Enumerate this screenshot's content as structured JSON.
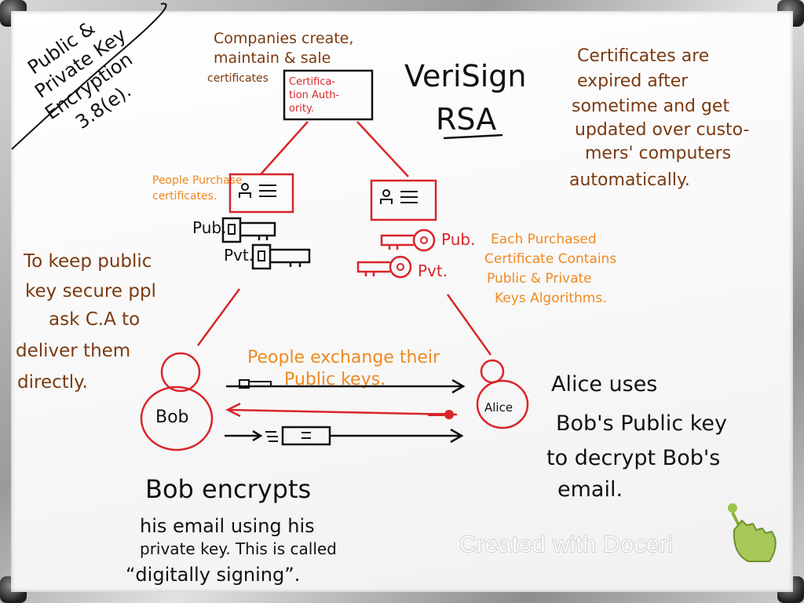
{
  "title_note": {
    "line1": "Public &",
    "line2": "Private Key",
    "line3": "Encryption",
    "line4": "3.8(e)."
  },
  "companies_note": {
    "line1": "Companies create,",
    "line2": "maintain & sale",
    "line3": "certificates"
  },
  "ca_box": {
    "line1": "Certifica-",
    "line2": "tion Auth-",
    "line3": "ority."
  },
  "verisign": {
    "line1": "VeriSign",
    "line2": "RSA"
  },
  "expiry_note": {
    "line1": "Certificates are",
    "line2": "expired after",
    "line3": "sometime and get",
    "line4": "updated over custo-",
    "line5": "mers' computers",
    "line6": "automatically."
  },
  "purchase_note": {
    "line1": "People Purchase",
    "line2": "certificates."
  },
  "key_labels": {
    "left_pub": "Pub.",
    "left_pvt": "Pvt.",
    "right_pub": "Pub.",
    "right_pvt": "Pvt."
  },
  "contains_note": {
    "line1": "Each Purchased",
    "line2": "Certificate Contains",
    "line3": "Public & Private",
    "line4": "Keys Algorithms."
  },
  "secure_note": {
    "line1": "To keep public",
    "line2": "key secure ppl",
    "line3": "ask C.A to",
    "line4": "deliver them",
    "line5": "directly."
  },
  "exchange_note": {
    "line1": "People exchange their",
    "line2": "Public keys."
  },
  "bob_label": "Bob",
  "alice_label": "Alice",
  "alice_note": {
    "line1": "Alice uses",
    "line2": "Bob's Public key",
    "line3": "to decrypt Bob's",
    "line4": "email."
  },
  "bob_note": {
    "line1": "Bob encrypts",
    "line2": "his email using his",
    "line3": "private key. This is called",
    "line4": "“digitally signing”."
  },
  "watermark": "Created with Doceri",
  "colors": {
    "brown": "#7a3a10",
    "orange": "#f0891f",
    "red": "#d9252a",
    "black": "#111111"
  }
}
